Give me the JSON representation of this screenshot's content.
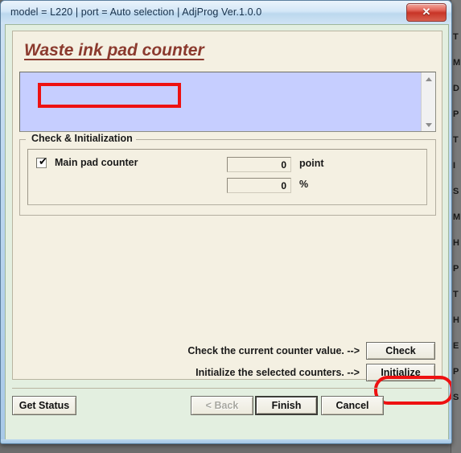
{
  "window": {
    "titlebar": "model = L220 | port = Auto selection | AdjProg Ver.1.0.0",
    "close_icon": "close-icon",
    "close_glyph": "✕"
  },
  "page": {
    "title": "Waste ink pad counter",
    "log": {
      "items": [],
      "scroll_up_icon": "scroll-up-arrow-icon",
      "scroll_down_icon": "scroll-down-arrow-icon"
    },
    "group": {
      "label": "Check & Initialization",
      "checkbox": {
        "label": "Main pad counter",
        "checked": true,
        "check_glyph": "✔"
      },
      "fields": [
        {
          "name": "point",
          "value": "0",
          "unit": "point"
        },
        {
          "name": "percent",
          "value": "0",
          "unit": "%"
        }
      ]
    },
    "actions": [
      {
        "caption": "Check the current counter value. -->",
        "button": "Check"
      },
      {
        "caption": "Initialize the selected counters. -->",
        "button": "Initialize"
      }
    ]
  },
  "footer": {
    "get_status": "Get Status",
    "back": "< Back",
    "finish": "Finish",
    "cancel": "Cancel"
  },
  "annotations": {
    "color": "#ee1111",
    "targets": [
      "main-pad-counter-checkbox",
      "check-button"
    ]
  },
  "background_window": {
    "lines": [
      "T",
      "M",
      "D",
      "P",
      "T",
      "I",
      "S",
      "M",
      "H",
      "P",
      "T",
      "H",
      "E",
      "P",
      "S"
    ]
  },
  "colors": {
    "page_background": "#f4f0e2",
    "client_background": "#e3efe0",
    "listbox_background": "#c6ceff",
    "title_color": "#8b3a2e",
    "frame": "#bcd8ee"
  }
}
